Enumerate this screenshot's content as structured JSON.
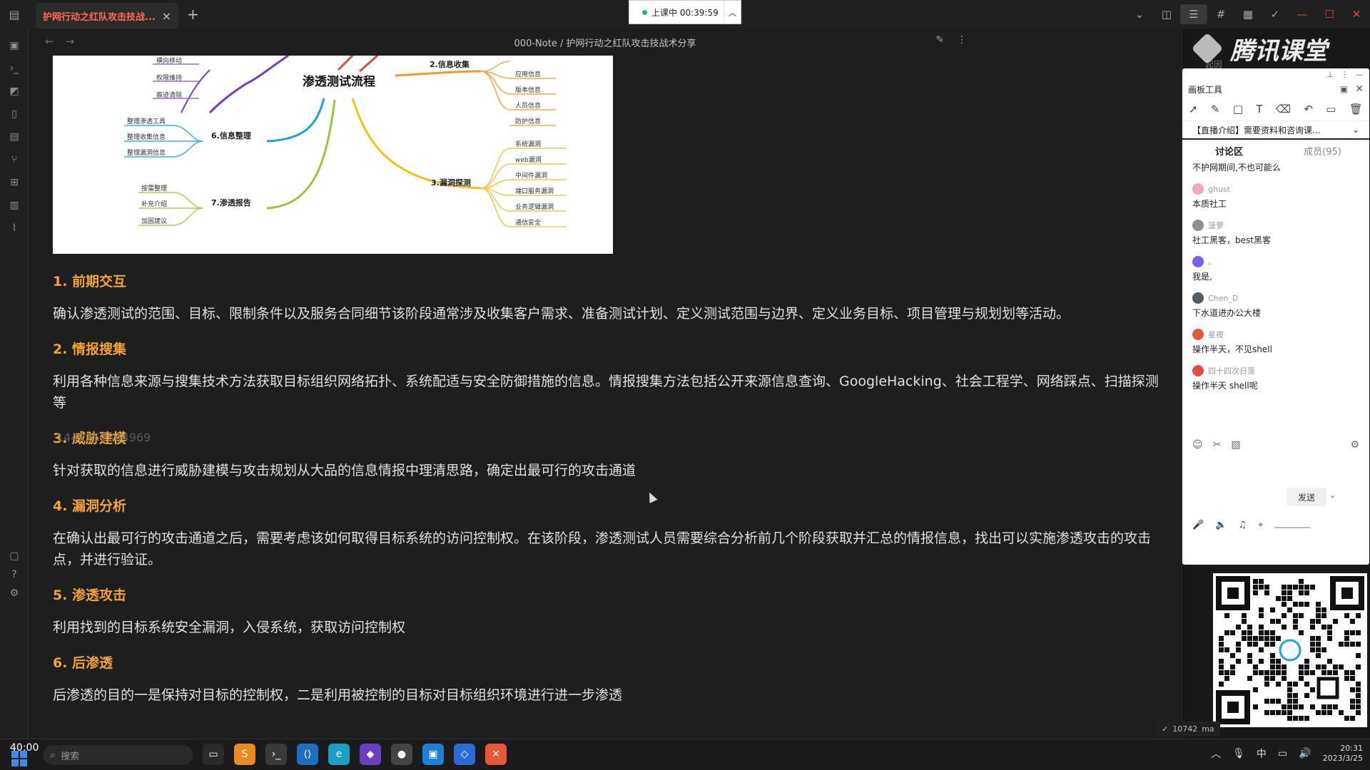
{
  "tabbar": {
    "tab_title": "护网行动之红队攻击技战...",
    "timer_text": "上课中 00:39:59"
  },
  "editor": {
    "breadcrumb": "000-Note / 护网行动之红队攻击技战术分享"
  },
  "mindmap": {
    "center": "渗透测试流程",
    "branches": [
      {
        "label": "2.信息收集",
        "leaves": [
          "应用信息",
          "版本信息",
          "人员信息",
          "防护信息"
        ]
      },
      {
        "label": "3.漏洞探测",
        "leaves": [
          "系统漏洞",
          "web漏洞",
          "中间件漏洞",
          "端口服务漏洞",
          "业务逻辑漏洞",
          "通信安全"
        ]
      },
      {
        "label": "6.信息整理",
        "leaves": [
          "整理渗透工具",
          "整理收集信息",
          "整理漏洞信息"
        ]
      },
      {
        "label": "7.渗透报告",
        "leaves": [
          "按需整理",
          "补充介绍",
          "加固建议"
        ]
      }
    ],
    "top_leaves": [
      "横向移动",
      "权限维持",
      "痕迹清除"
    ]
  },
  "sections": [
    {
      "heading": "1. 前期交互",
      "body": "确认渗透测试的范围、目标、限制条件以及服务合同细节该阶段通常涉及收集客户需求、准备测试计划、定义测试范围与边界、定义业务目标、项目管理与规划划等活动。"
    },
    {
      "heading": "2. 情报搜集",
      "body": "利用各种信息来源与搜集技术方法获取目标组织网络拓扑、系统配适与安全防御措施的信息。情报搜集方法包括公开来源信息查询、GoogleHacking、社会工程学、网络踩点、扫描探测等"
    },
    {
      "heading": "3. 威胁建模",
      "body": "针对获取的信息进行威胁建模与攻击规划从大品的信息情报中理清思路，确定出最可行的攻击通道"
    },
    {
      "heading": "4. 漏洞分析",
      "body": "在确认出最可行的攻击通道之后，需要考虑该如何取得目标系统的访问控制权。在该阶段，渗透测试人员需要综合分析前几个阶段获取并汇总的情报信息，找出可以实施渗透攻击的攻击点，并进行验证。"
    },
    {
      "heading": "5. 渗透攻击",
      "body": "利用找到的目标系统安全漏洞，入侵系统，获取访问控制权"
    },
    {
      "heading": "6. 后渗透",
      "body": "后渗透的目的一是保持对目标的控制权，二是利用被控制的目标对目标组织环境进行进一步渗透"
    }
  ],
  "ghost_number": "1441152344969",
  "right_panel": {
    "brand": "腾讯课堂",
    "sub": "起因"
  },
  "classroom": {
    "title": "画板工具",
    "course": "【直播介绍】需要资料和咨询课...",
    "tab_discuss": "讨论区",
    "tab_members": "成员(95)",
    "top_msg": "不护网期间,不也可能么",
    "messages": [
      {
        "user": "ghust",
        "text": "本质社工",
        "color": "#f1a7b8"
      },
      {
        "user": "菠萝",
        "text": "社工黑客，best黑客",
        "color": "#8a8f99"
      },
      {
        "user": "。",
        "text": "我是,",
        "color": "#7b5cf0"
      },
      {
        "user": "Chen_D",
        "text": "下水道进办公大楼",
        "color": "#555b66"
      },
      {
        "user": "星夜",
        "text": "操作半天，不见shell",
        "color": "#e2583e"
      },
      {
        "user": "四十四次日落",
        "text": "操作半天 shell呢",
        "color": "#e14b4b"
      }
    ],
    "send_label": "发送"
  },
  "status": {
    "count": "10742",
    "suffix": "ma"
  },
  "taskbar": {
    "left_time": "40:00",
    "search_placeholder": "搜索",
    "clock_time": "20:31",
    "clock_date": "2023/3/25"
  }
}
